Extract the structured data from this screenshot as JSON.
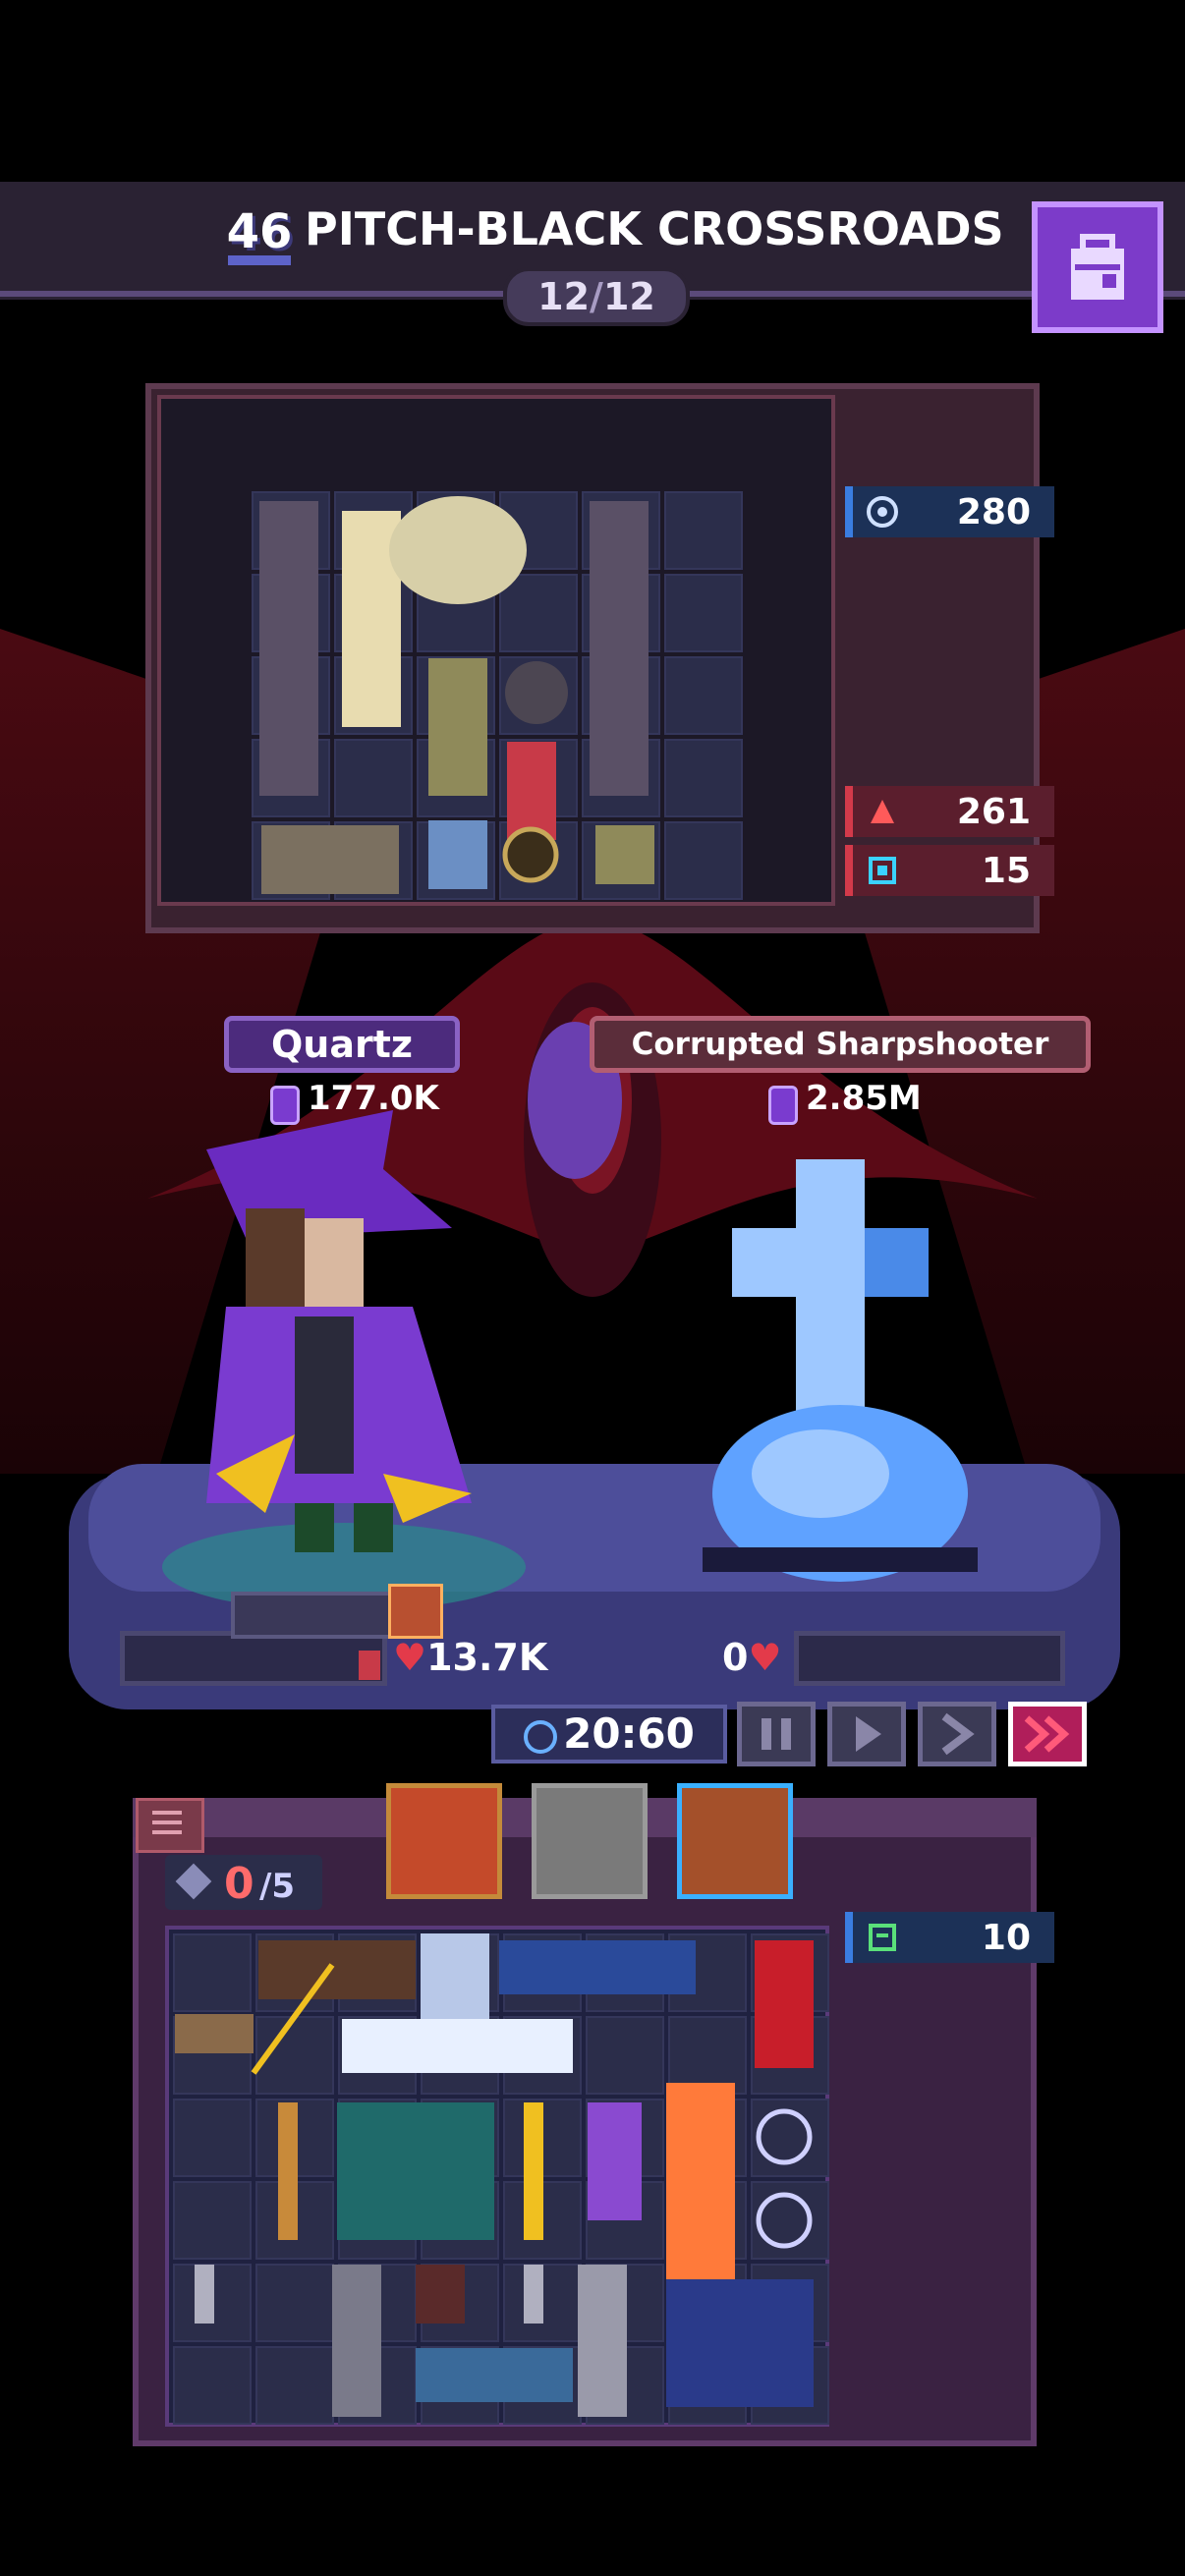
{
  "header": {
    "level": "46",
    "title": "PITCH-BLACK CROSSROADS",
    "progress_current": "12",
    "progress_total": "12"
  },
  "enemy_stats": {
    "armor": "280",
    "attack": "261",
    "defense": "15"
  },
  "hero": {
    "name": "Quartz",
    "power": "177.0K",
    "hp": "13.7K"
  },
  "enemy": {
    "name": "Corrupted Sharpshooter",
    "power": "2.85M",
    "hp": "0"
  },
  "battle": {
    "timer": "20:60",
    "controls": [
      "pause-icon",
      "play-icon",
      "fast-forward-icon",
      "double-fast-forward-icon"
    ]
  },
  "inventory": {
    "slots_used": "0",
    "slots_total": "/5",
    "energy": "10",
    "characters": [
      "character-dragon",
      "character-ghost",
      "character-rogue"
    ]
  },
  "colors": {
    "accent_purple": "#7c3bc9",
    "enemy_red": "#5b1e2d",
    "stat_blue": "#1c3157"
  }
}
